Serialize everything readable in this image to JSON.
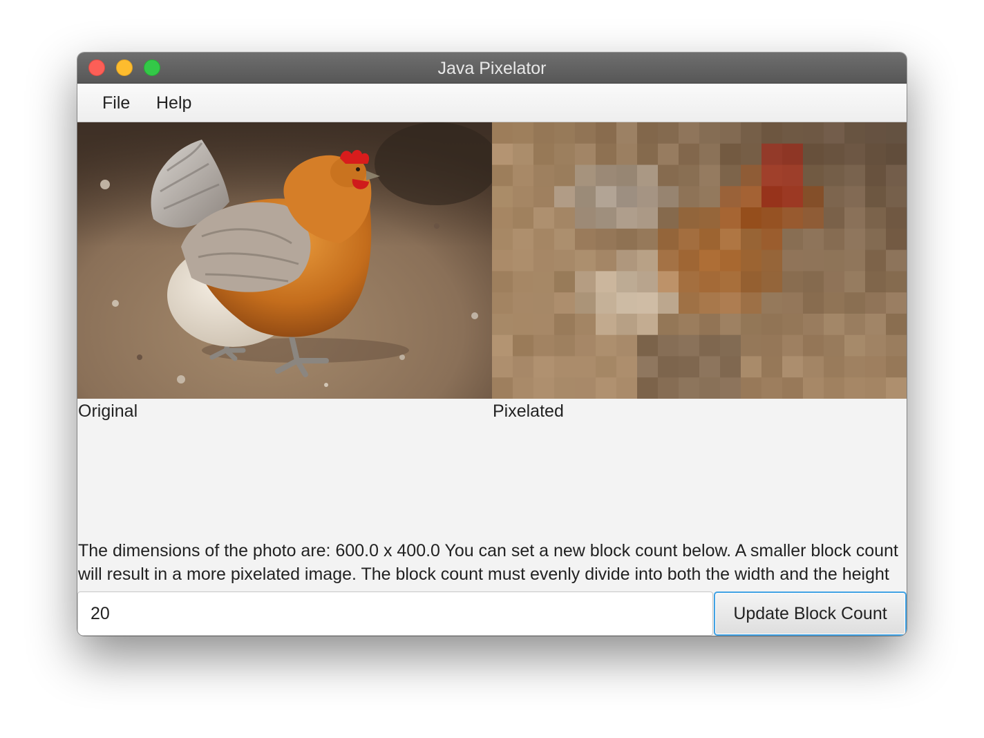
{
  "window": {
    "title": "Java Pixelator"
  },
  "menu": {
    "items": [
      {
        "label": "File"
      },
      {
        "label": "Help"
      }
    ]
  },
  "images": {
    "original_label": "Original",
    "pixelated_label": "Pixelated",
    "original_icon": "hen-photo",
    "pixelated_icon": "hen-photo-pixelated"
  },
  "info": {
    "text": "The dimensions of the photo are: 600.0 x 400.0 You can set a new block count below. A smaller block count will result in a more pixelated image. The block count must evenly divide into both the width and the height of ..."
  },
  "controls": {
    "block_count_value": "20",
    "update_button_label": "Update Block Count"
  },
  "colors": {
    "titlebar": "#616161",
    "close": "#fc5f57",
    "minimize": "#fdbc2e",
    "maximize": "#33c848",
    "button_focus": "#3fa1e3"
  }
}
